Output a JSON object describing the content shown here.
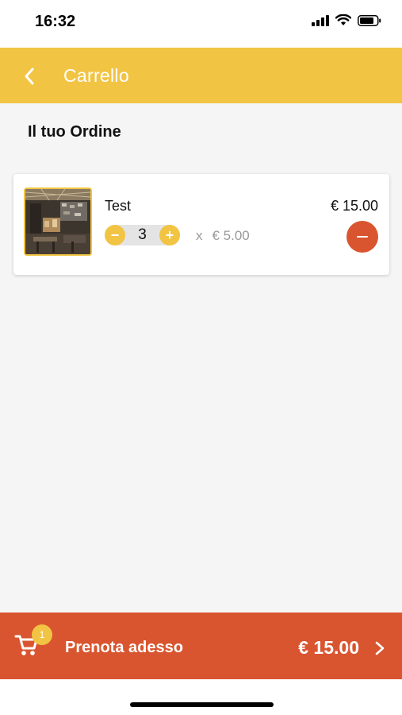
{
  "status_bar": {
    "time": "16:32",
    "icons": [
      "signal-icon",
      "wifi-icon",
      "battery-icon"
    ]
  },
  "header": {
    "back_icon": "chevron-left-icon",
    "title": "Carrello",
    "background": "#f2c443"
  },
  "section_title": "Il tuo Ordine",
  "cart": {
    "items": [
      {
        "name": "Test",
        "quantity": "3",
        "unit_price_prefix": "x",
        "unit_price": "€ 5.00",
        "total": "€ 15.00",
        "minus_label": "−",
        "plus_label": "+"
      }
    ]
  },
  "checkout": {
    "cart_icon": "cart-icon",
    "badge": "1",
    "label": "Prenota adesso",
    "total": "€ 15.00",
    "chevron_icon": "chevron-right-icon",
    "background": "#d9552f"
  }
}
